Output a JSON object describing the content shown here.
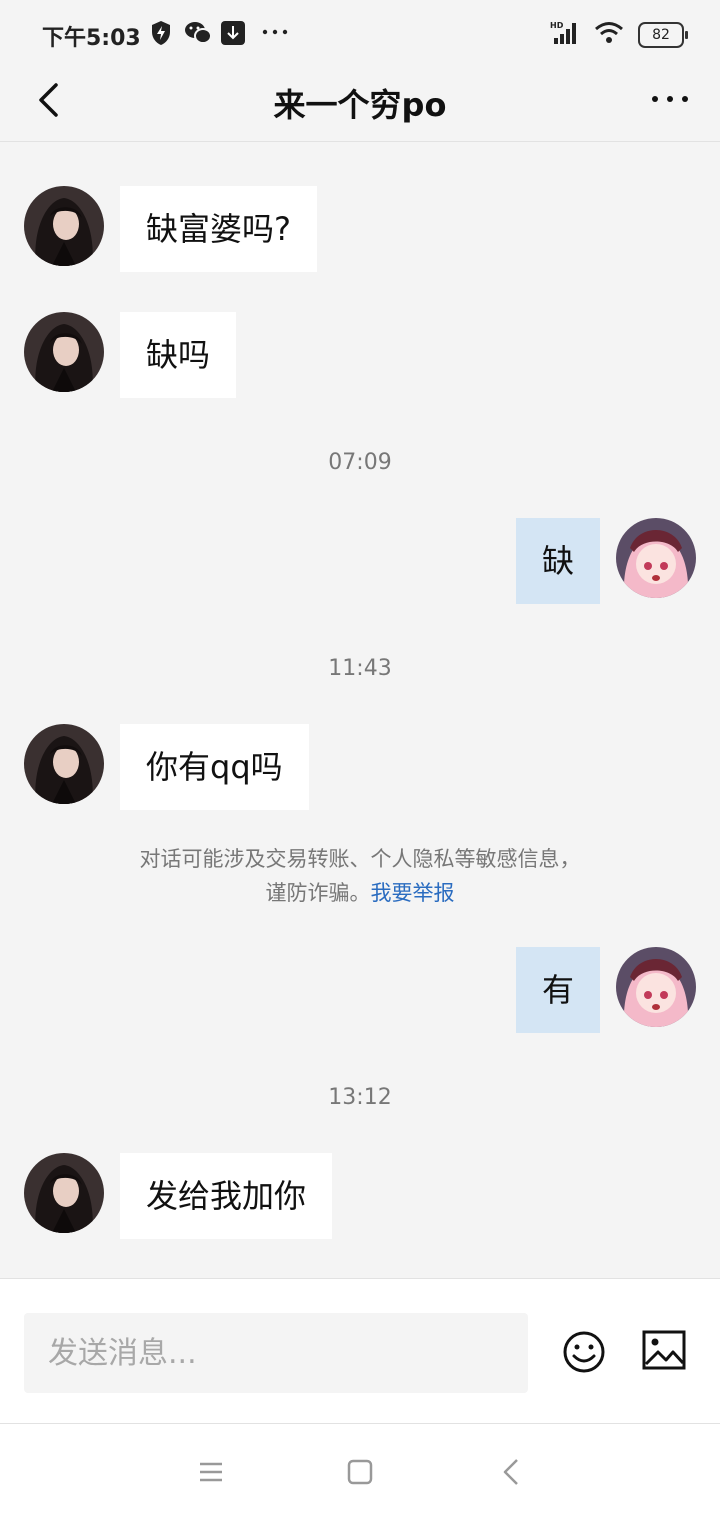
{
  "status_bar": {
    "time": "下午5:03",
    "battery": "82",
    "icons": [
      "shield-bolt-icon",
      "wechat-icon",
      "download-icon",
      "more-dots-icon",
      "hd-signal-icon",
      "wifi-icon",
      "battery-icon"
    ]
  },
  "header": {
    "title": "来一个穷po",
    "back_icon": "chevron-left-icon",
    "more_icon": "more-dots-icon"
  },
  "messages": [
    {
      "side": "left",
      "text": "缺富婆吗?"
    },
    {
      "side": "left",
      "text": "缺吗"
    },
    {
      "type": "time",
      "text": "07:09"
    },
    {
      "side": "right",
      "text": "缺"
    },
    {
      "type": "time",
      "text": "11:43"
    },
    {
      "side": "left",
      "text": "你有qq吗"
    },
    {
      "type": "notice",
      "line1": "对话可能涉及交易转账、个人隐私等敏感信息，",
      "line2": "谨防诈骗。",
      "link": "我要举报"
    },
    {
      "side": "right",
      "text": "有"
    },
    {
      "type": "time",
      "text": "13:12"
    },
    {
      "side": "left",
      "text": "发给我加你"
    }
  ],
  "input": {
    "placeholder": "发送消息...",
    "value": "",
    "emoji_icon": "smiley-icon",
    "image_icon": "image-icon"
  },
  "nav": {
    "icons": [
      "menu-icon",
      "home-square-icon",
      "back-chevron-icon"
    ]
  },
  "colors": {
    "background": "#f4f4f4",
    "bubble_left": "#ffffff",
    "bubble_right": "#d4e5f4",
    "link": "#2a6cc0",
    "timestamp": "#777777"
  }
}
